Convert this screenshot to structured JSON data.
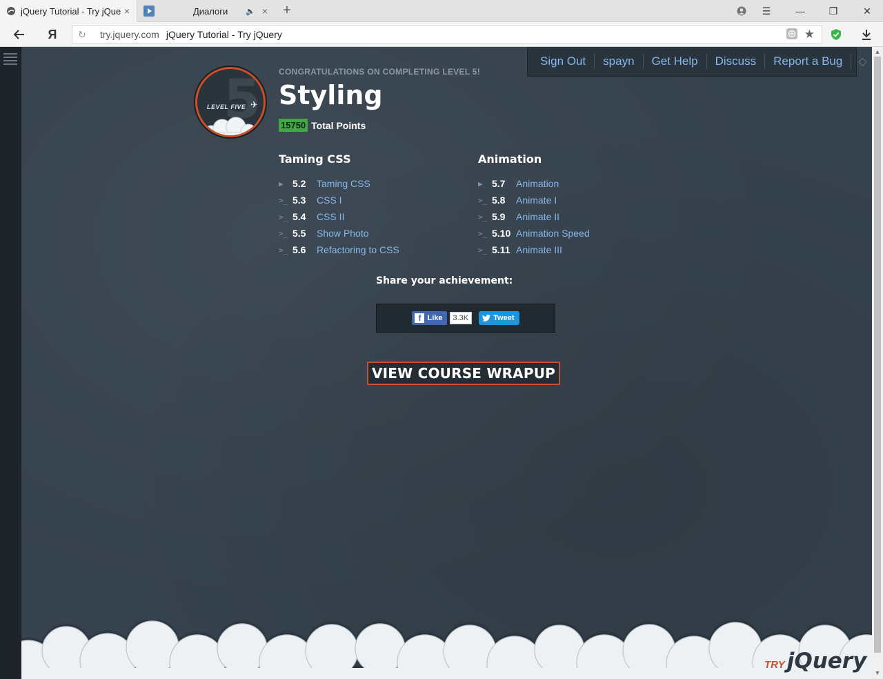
{
  "browser": {
    "tabs": [
      {
        "title": "jQuery Tutorial - Try jQue",
        "close": "×"
      },
      {
        "title": "Диалоги",
        "close": "×"
      }
    ],
    "new_tab": "+",
    "url_host": "try.jquery.com",
    "url_title": "jQuery Tutorial - Try jQuery",
    "yandex_button": "Я"
  },
  "nav": {
    "links": [
      "Sign Out",
      "spayn",
      "Get Help",
      "Discuss",
      "Report a Bug"
    ],
    "code_icon": "◇"
  },
  "badge": {
    "number": "5",
    "label": "LEVEL FIVE"
  },
  "header": {
    "congrats": "CONGRATULATIONS ON COMPLETING LEVEL 5!",
    "title": "Styling",
    "points_value": "15750",
    "points_label": "Total Points"
  },
  "sections": [
    {
      "heading": "Taming CSS",
      "items": [
        {
          "icon": "▶",
          "num": "5.2",
          "title": "Taming CSS"
        },
        {
          "icon": ">_",
          "num": "5.3",
          "title": "CSS I"
        },
        {
          "icon": ">_",
          "num": "5.4",
          "title": "CSS II"
        },
        {
          "icon": ">_",
          "num": "5.5",
          "title": "Show Photo"
        },
        {
          "icon": ">_",
          "num": "5.6",
          "title": "Refactoring to CSS"
        }
      ]
    },
    {
      "heading": "Animation",
      "items": [
        {
          "icon": "▶",
          "num": "5.7",
          "title": "Animation"
        },
        {
          "icon": ">_",
          "num": "5.8",
          "title": "Animate I"
        },
        {
          "icon": ">_",
          "num": "5.9",
          "title": "Animate II"
        },
        {
          "icon": ">_",
          "num": "5.10",
          "title": "Animation Speed"
        },
        {
          "icon": ">_",
          "num": "5.11",
          "title": "Animate III"
        }
      ]
    }
  ],
  "share": {
    "heading": "Share your achievement:",
    "like_label": "Like",
    "like_count": "3.3K",
    "tweet_label": "Tweet"
  },
  "cta": {
    "label": "VIEW COURSE WRAPUP"
  },
  "footer": {
    "logo_try": "TRY",
    "logo_jquery": "jQuery"
  },
  "colors": {
    "accent": "#c8502a",
    "link": "#86b7ee",
    "points_badge": "#41a845",
    "background": "#36424d"
  }
}
